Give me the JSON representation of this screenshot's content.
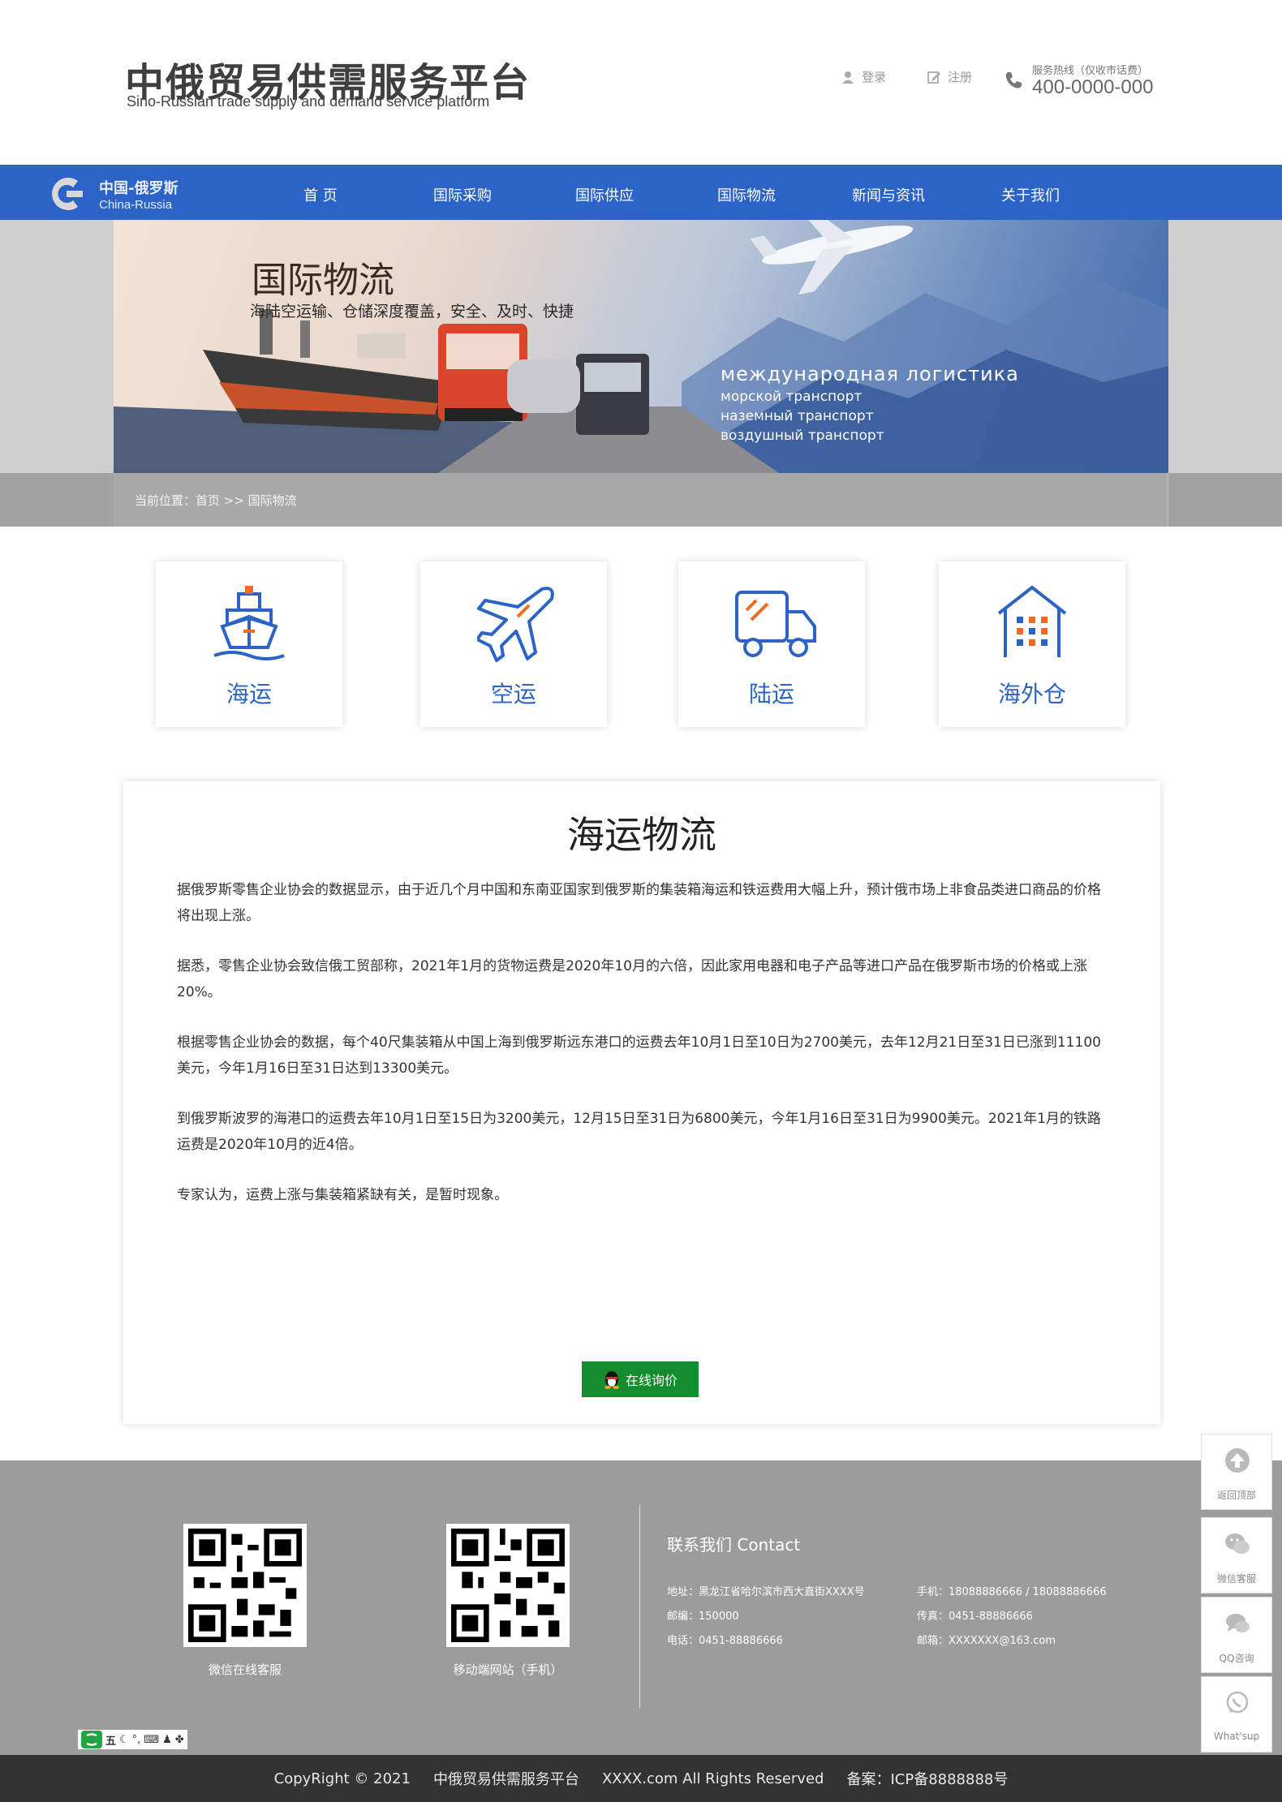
{
  "header": {
    "logo_cn": "中俄贸易供需服务平台",
    "logo_en": "Sino-Russian trade supply and demand service platform",
    "login": "登录",
    "register": "注册",
    "hotline_label": "服务热线（仅收市话费）",
    "hotline_number": "400-0000-000"
  },
  "nav": {
    "logo_cn": "中国-俄罗斯",
    "logo_en": "China-Russia",
    "items": [
      "首 页",
      "国际采购",
      "国际供应",
      "国际物流",
      "新闻与资讯",
      "关于我们"
    ]
  },
  "banner": {
    "title": "国际物流",
    "subtitle": "海陆空运输、仓储深度覆盖，安全、及时、快捷",
    "ru_title": "международная логистика",
    "ru_lines": [
      "морской транспорт",
      "наземный транспорт",
      "воздушный транспорт"
    ]
  },
  "breadcrumb": "当前位置：首页 >> 国际物流",
  "services": [
    {
      "label": "海运",
      "icon": "ship-icon"
    },
    {
      "label": "空运",
      "icon": "airplane-icon"
    },
    {
      "label": "陆运",
      "icon": "truck-icon"
    },
    {
      "label": "海外仓",
      "icon": "warehouse-icon"
    }
  ],
  "article": {
    "title": "海运物流",
    "paragraphs": [
      "据俄罗斯零售企业协会的数据显示，由于近几个月中国和东南亚国家到俄罗斯的集装箱海运和铁运费用大幅上升，预计俄市场上非食品类进口商品的价格将出现上涨。",
      "据悉，零售企业协会致信俄工贸部称，2021年1月的货物运费是2020年10月的六倍，因此家用电器和电子产品等进口产品在俄罗斯市场的价格或上涨20%。",
      "根据零售企业协会的数据，每个40尺集装箱从中国上海到俄罗斯远东港口的运费去年10月1日至10日为2700美元，去年12月21日至31日已涨到11100美元，今年1月16日至31日达到13300美元。",
      "到俄罗斯波罗的海港口的运费去年10月1日至15日为3200美元，12月15日至31日为6800美元，今年1月16日至31日为9900美元。2021年1月的铁路运费是2020年10月的近4倍。",
      "专家认为，运费上涨与集装箱紧缺有关，是暂时现象。"
    ],
    "inquiry_button": "在线询价"
  },
  "footer": {
    "qr_labels": [
      "微信在线客服",
      "移动端网站（手机）"
    ],
    "contact_title": "联系我们 Contact",
    "address": "地址：黑龙江省哈尔滨市西大直街XXXX号",
    "postcode": "邮编：150000",
    "phone": "电话：0451-88886666",
    "mobile": "手机：18088886666 / 18088886666",
    "fax": "传真：0451-88886666",
    "email": "邮箱：XXXXXXX@163.com",
    "ime_label": "五"
  },
  "bottom": {
    "copyright": "CopyRight © 2021",
    "site_name": "中俄贸易供需服务平台",
    "rights": "XXXX.com All Rights Reserved",
    "icp": "备案：ICP备8888888号"
  },
  "float": [
    "返回顶部",
    "微信客服",
    "QQ咨询",
    "What'sup"
  ],
  "colors": {
    "brand_blue": "#2b63c6",
    "accent_orange": "#f26b22",
    "button_green": "#128c2c"
  }
}
